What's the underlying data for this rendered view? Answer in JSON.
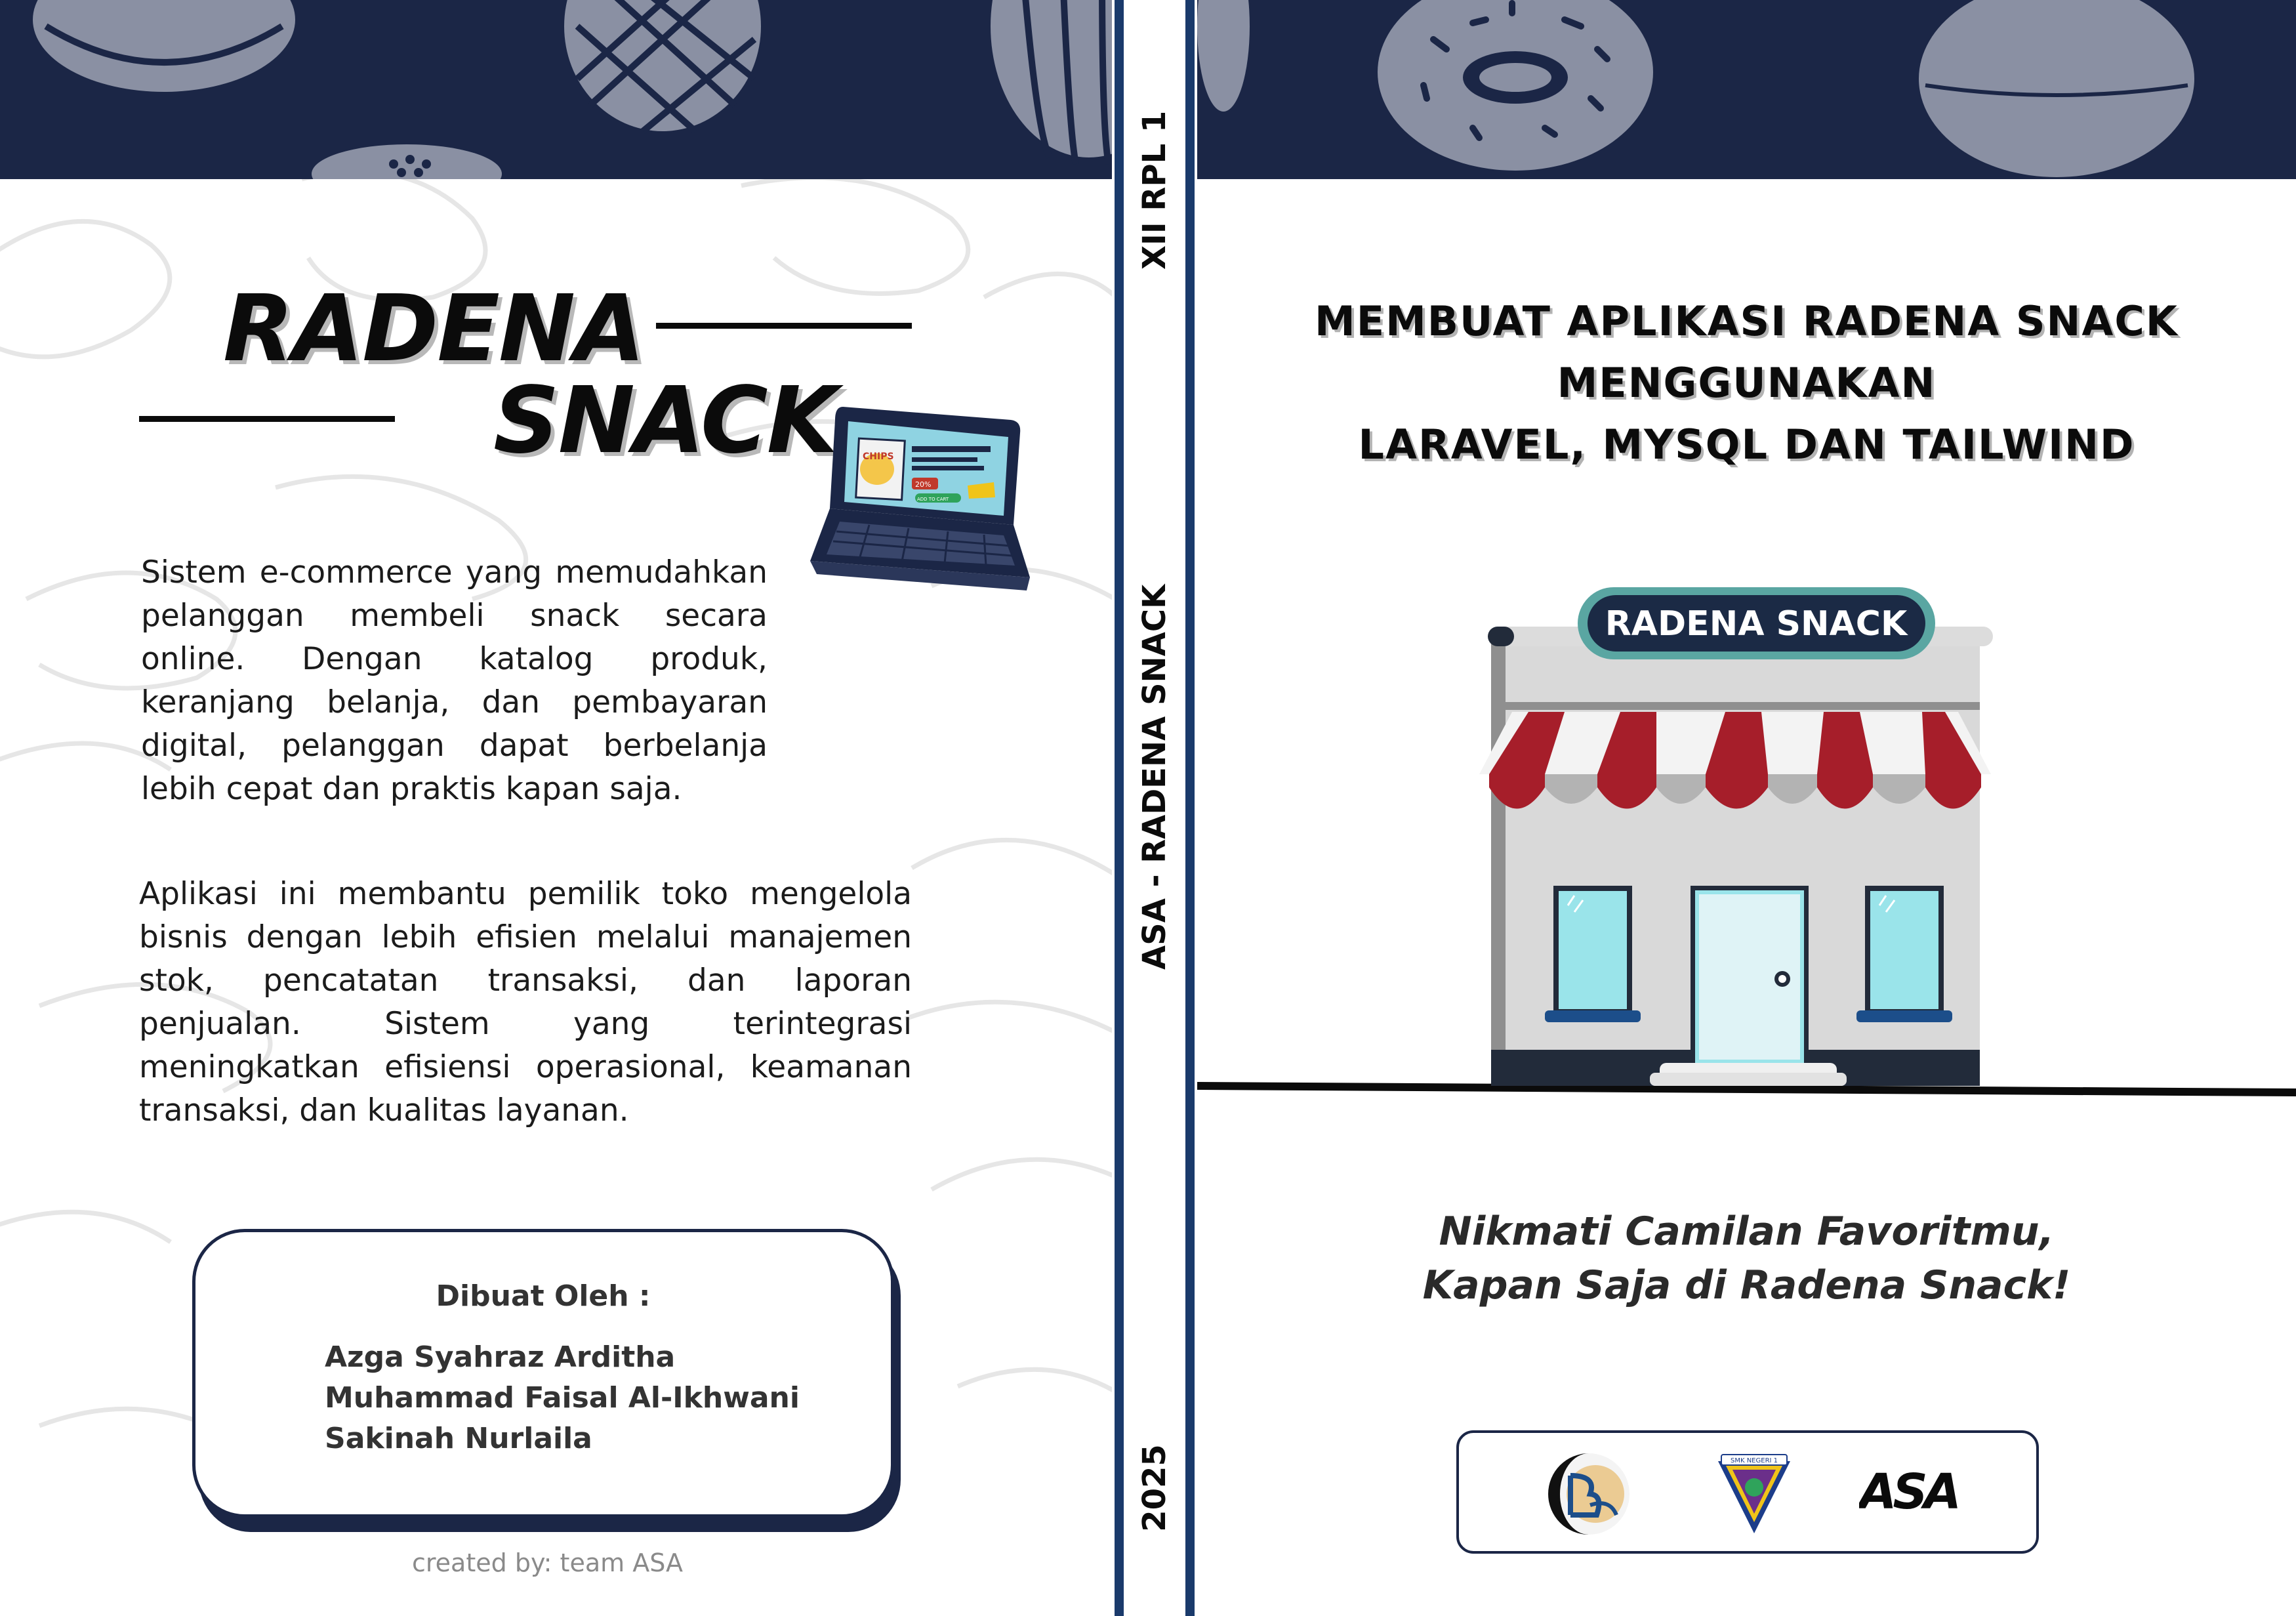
{
  "back_cover": {
    "title_line1": "RADENA",
    "title_line2": "SNACK",
    "paragraph1": "Sistem e-commerce yang memudahkan pelanggan membeli snack secara online. Dengan katalog produk, keranjang belanja, dan pembayaran digital, pelanggan dapat berbelanja lebih cepat dan praktis kapan saja.",
    "paragraph2": "Aplikasi ini membantu pemilik toko mengelola bisnis dengan lebih efisien melalui manajemen stok, pencatatan transaksi, dan laporan penjualan. Sistem yang terintegrasi meningkatkan efisiensi operasional, keamanan transaksi, dan kualitas layanan.",
    "credits_heading": "Dibuat Oleh :",
    "authors": [
      "Azga Syahraz Arditha",
      "Muhammad Faisal Al-Ikhwani",
      "Sakinah Nurlaila"
    ],
    "footer": "created by: team ASA",
    "laptop_screen": {
      "chips_label": "CHIPS",
      "price_badge": "20%",
      "button_label": "ADD TO CART"
    }
  },
  "spine": {
    "class_label": "XII RPL 1",
    "book_label": "ASA - RADENA SNACK",
    "year": "2025"
  },
  "front_cover": {
    "title_lines": [
      "MEMBUAT APLIKASI RADENA SNACK",
      "MENGGUNAKAN",
      "LARAVEL, MYSQL DAN TAILWIND"
    ],
    "store_sign": "RADENA SNACK",
    "tagline_lines": [
      "Nikmati Camilan Favoritmu,",
      "Kapan Saja di Radena Snack!"
    ],
    "logos": {
      "logo3_text": "ASA",
      "school_badge_text": "SMK NEGERI 1"
    }
  },
  "colors": {
    "navy": "#1b2646",
    "spine_blue": "#1a3a6b",
    "awning_red": "#a61e2a",
    "window_cyan": "#9ae4ea",
    "sign_teal": "#5aa6a2"
  }
}
